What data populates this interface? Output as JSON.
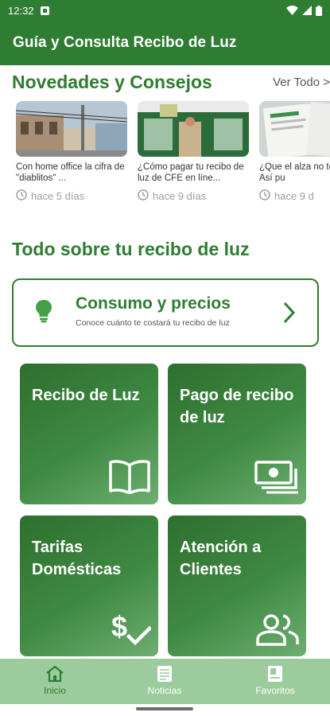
{
  "status_bar": {
    "time": "12:32"
  },
  "app_bar": {
    "title": "Guía y Consulta Recibo de Luz"
  },
  "news": {
    "title": "Novedades y Consejos",
    "see_all": "Ver Todo >",
    "items": [
      {
        "headline": "Con home office la cifra de \"diablitos\" ...",
        "time": "hace 5 días"
      },
      {
        "headline": "¿Cómo pagar tu recibo de luz de CFE en líne...",
        "time": "hace 9 días"
      },
      {
        "headline": "¿Que el alza no te afecte! Así pu",
        "time": "hace 9 d"
      }
    ]
  },
  "section": {
    "title": "Todo sobre tu recibo de luz"
  },
  "consumo": {
    "title": "Consumo y precios",
    "subtitle": "Conoce cuánto te costará tu recibo de luz"
  },
  "tiles": [
    {
      "label": "Recibo de Luz",
      "icon": "book-icon"
    },
    {
      "label": "Pago de recibo de luz",
      "icon": "money-icon"
    },
    {
      "label": "Tarifas Domésticas",
      "icon": "price-check-icon"
    },
    {
      "label": "Atención a Clientes",
      "icon": "people-icon"
    }
  ],
  "bottom_nav": {
    "items": [
      {
        "label": "Inicio",
        "icon": "home-icon",
        "active": true
      },
      {
        "label": "Noticias",
        "icon": "news-icon",
        "active": false
      },
      {
        "label": "Favoritos",
        "icon": "favorites-icon",
        "active": false
      }
    ]
  },
  "colors": {
    "primary": "#2e7d32",
    "nav_bg": "#9ccc9d",
    "tile_dark": "#2e6f2f",
    "tile_light": "#6fae72"
  }
}
